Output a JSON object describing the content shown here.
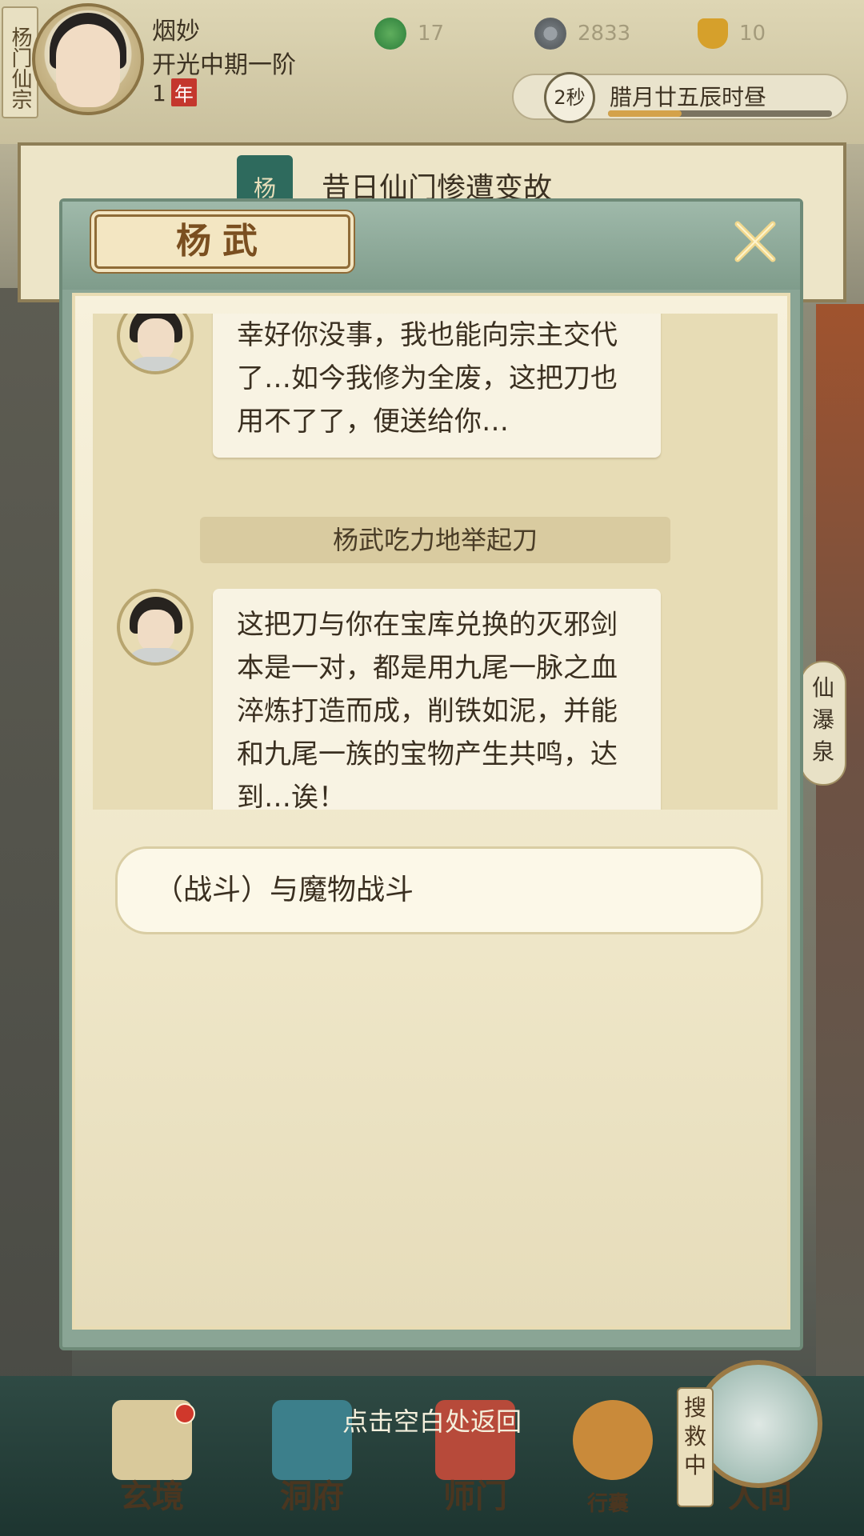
{
  "player": {
    "sect": "杨门仙宗",
    "name": "烟妙",
    "realm": "开光中期一阶",
    "age_value": "1",
    "age_unit": "年"
  },
  "resources": [
    {
      "icon": "jade-icon",
      "value": "17"
    },
    {
      "icon": "coin-icon",
      "value": "2833"
    },
    {
      "icon": "gold-ingot-icon",
      "value": "10"
    }
  ],
  "time": {
    "seconds": "2秒",
    "date": "腊月廿五辰时昼",
    "progress": 0.33
  },
  "event": {
    "tag": "杨",
    "title": "昔日仙门惨遭变故"
  },
  "side_label": "仙瀑泉",
  "dialog": {
    "title": "杨武",
    "messages": [
      {
        "text": "幸好你没事，我也能向宗主交代了…如今我修为全废，这把刀也用不了了，便送给你…"
      },
      {
        "text": "这把刀与你在宝库兑换的灭邪剑本是一对，都是用九尾一脉之血淬炼打造而成，削铁如泥，并能和九尾一族的宝物产生共鸣，达到…诶！"
      }
    ],
    "narration": "杨武吃力地举起刀",
    "choice": "（战斗）与魔物战斗"
  },
  "return_hint": "点击空白处返回",
  "nav": {
    "xuanjing": "玄境",
    "dongfu": "洞府",
    "shimen": "师门",
    "xingnang": "行囊",
    "renjian": "人间",
    "rescue": "搜救中"
  },
  "colors": {
    "accent_red": "#c4372d",
    "dialog_green": "#8aa595",
    "paper": "#f7f1dc"
  }
}
